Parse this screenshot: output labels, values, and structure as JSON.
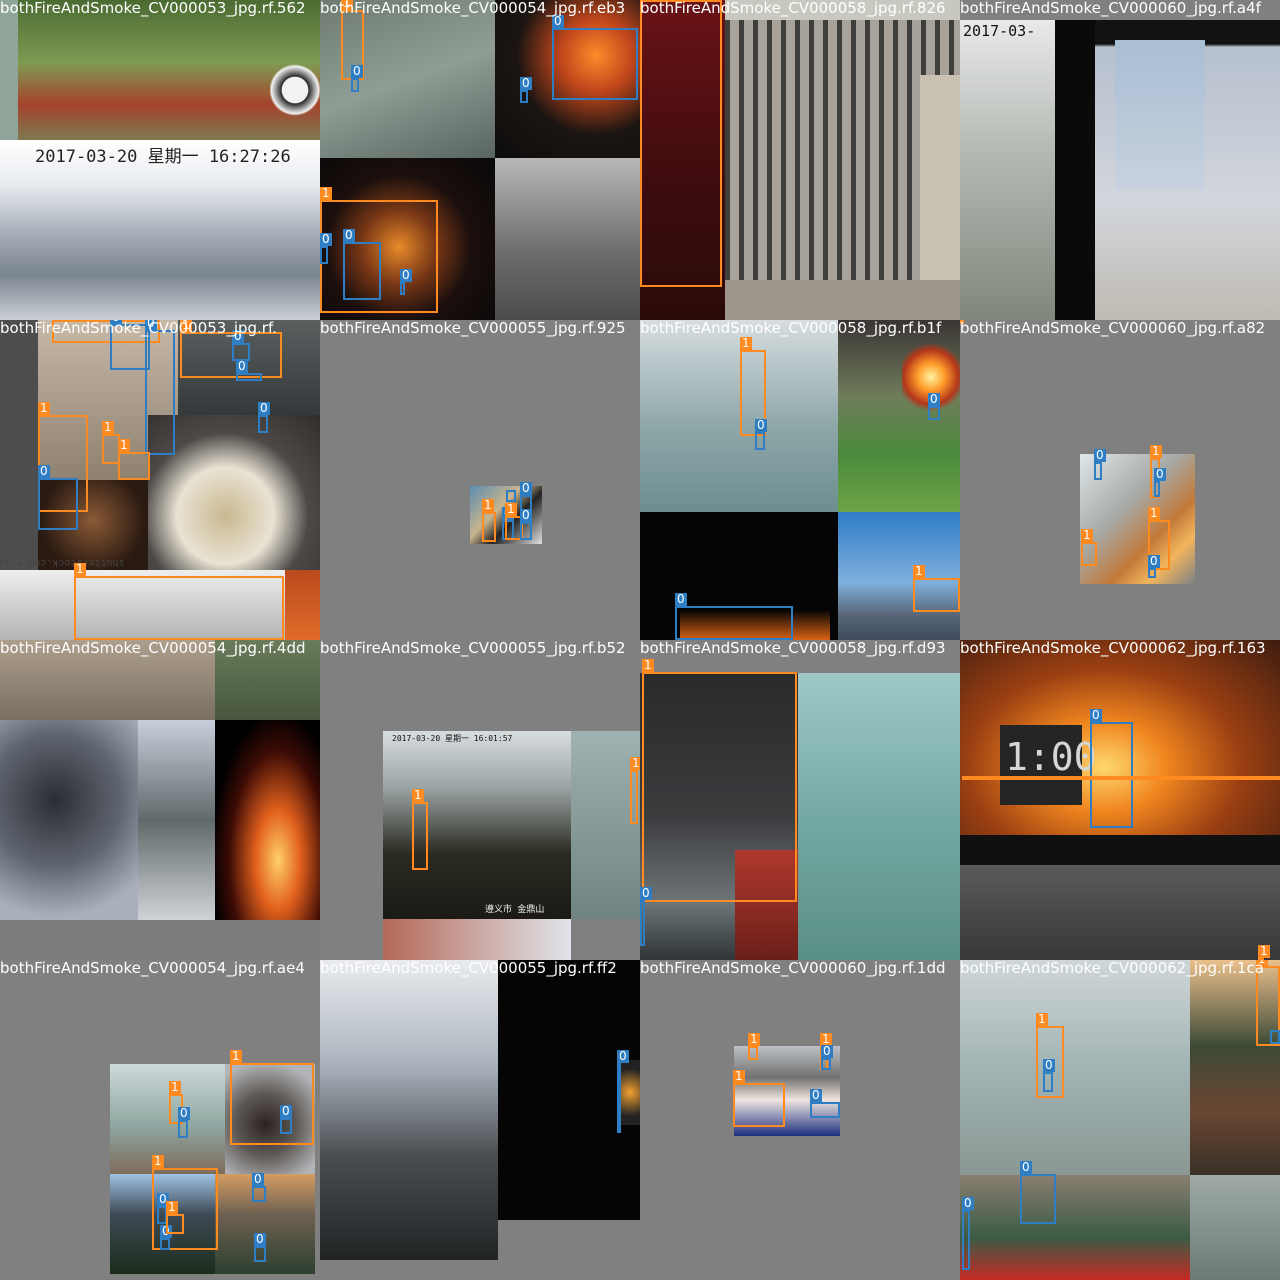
{
  "colors": {
    "fire": "#ff8a1f",
    "smoke": "#2f7ec4",
    "pad_gray": "#808080"
  },
  "class_labels": {
    "fire": "1",
    "smoke": "0"
  },
  "tiles": [
    {
      "title": "bothFireAndSmoke_CV000053_jpg.rf.562",
      "captions": [
        "2017-03-20  星期一  16:27:26"
      ]
    },
    {
      "title": "bothFireAndSmoke_CV000054_jpg.rf.eb3",
      "captions": []
    },
    {
      "title": "bothFireAndSmoke_CV000058_jpg.rf.826",
      "captions": []
    },
    {
      "title": "bothFireAndSmoke_CV000060_jpg.rf.a4f",
      "captions": [
        "2017-03-"
      ]
    },
    {
      "title": "bothFireAndSmoke_CV000053_jpg.rf.",
      "captions": [
        "shutterstock.com • 1446066902"
      ]
    },
    {
      "title": "bothFireAndSmoke_CV000055_jpg.rf.925",
      "captions": []
    },
    {
      "title": "bothFireAndSmoke_CV000058_jpg.rf.b1f",
      "captions": []
    },
    {
      "title": "bothFireAndSmoke_CV000060_jpg.rf.a82",
      "captions": []
    },
    {
      "title": "bothFireAndSmoke_CV000054_jpg.rf.4dd",
      "captions": []
    },
    {
      "title": "bothFireAndSmoke_CV000055_jpg.rf.b52",
      "captions": [
        "2017-03-20  星期一  16:01:57",
        "遵义市 金鼎山"
      ]
    },
    {
      "title": "bothFireAndSmoke_CV000058_jpg.rf.d93",
      "captions": []
    },
    {
      "title": "bothFireAndSmoke_CV000062_jpg.rf.163",
      "captions": [
        "1:00"
      ]
    },
    {
      "title": "bothFireAndSmoke_CV000054_jpg.rf.ae4",
      "captions": []
    },
    {
      "title": "bothFireAndSmoke_CV000055_jpg.rf.ff2",
      "captions": []
    },
    {
      "title": "bothFireAndSmoke_CV000060_jpg.rf.1dd",
      "captions": []
    },
    {
      "title": "bothFireAndSmoke_CV000062_jpg.rf.1ca",
      "captions": []
    }
  ]
}
